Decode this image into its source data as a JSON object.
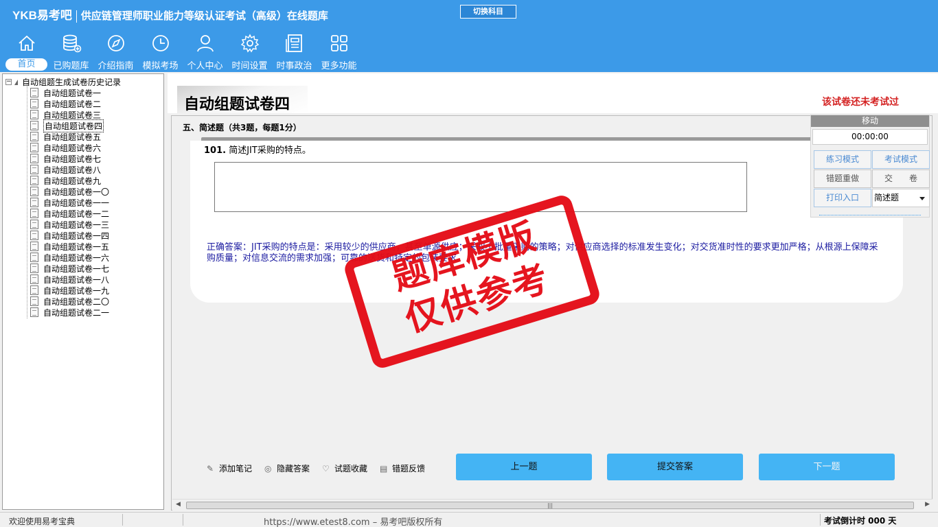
{
  "header": {
    "logo": "YKB易考吧",
    "title": "供应链管理师职业能力等级认证考试（高级）在线题库",
    "switch_label": "切换科目"
  },
  "nav": [
    {
      "label": "首页",
      "icon": "home-icon"
    },
    {
      "label": "已购题库",
      "icon": "database-icon"
    },
    {
      "label": "介绍指南",
      "icon": "compass-icon"
    },
    {
      "label": "模拟考场",
      "icon": "clock-icon"
    },
    {
      "label": "个人中心",
      "icon": "user-icon"
    },
    {
      "label": "时间设置",
      "icon": "gear-icon"
    },
    {
      "label": "时事政治",
      "icon": "newspaper-icon"
    },
    {
      "label": "更多功能",
      "icon": "grid-icon"
    }
  ],
  "tree": {
    "root": "自动组题生成试卷历史记录",
    "items": [
      "自动组题试卷一",
      "自动组题试卷二",
      "自动组题试卷三",
      "自动组题试卷四",
      "自动组题试卷五",
      "自动组题试卷六",
      "自动组题试卷七",
      "自动组题试卷八",
      "自动组题试卷九",
      "自动组题试卷一〇",
      "自动组题试卷一一",
      "自动组题试卷一二",
      "自动组题试卷一三",
      "自动组题试卷一四",
      "自动组题试卷一五",
      "自动组题试卷一六",
      "自动组题试卷一七",
      "自动组题试卷一八",
      "自动组题试卷一九",
      "自动组题试卷二〇",
      "自动组题试卷二一"
    ],
    "selected_index": 3
  },
  "paper": {
    "title": "自动组题试卷四",
    "status": "该试卷还未考试过",
    "section": "五、简述题（共3题，每题1分）",
    "question_number": "101.",
    "question_text": " 简述JIT采购的特点。",
    "answer_value": "",
    "correct_answer": "正确答案：JIT采购的特点是：采用较少的供应商，甚至单源供应；采取小批量采购的策略；对供应商选择的标准发生变化；对交货准时性的要求更加严格；从根源上保障采购质量；对信息交流的需求加强；可靠的送货和特定的包装要求。"
  },
  "float_panel": {
    "move_label": "移动",
    "timer": "00:00:00",
    "practice_mode": "练习模式",
    "exam_mode": "考试模式",
    "redo_wrong": "错题重做",
    "submit_paper": "交　　卷",
    "print_entry": "打印入口",
    "question_type": "简述题"
  },
  "tools": {
    "add_note": "添加笔记",
    "hide_answer": "隐藏答案",
    "favorite": "试题收藏",
    "feedback": "错题反馈"
  },
  "buttons": {
    "prev": "上一题",
    "submit": "提交答案",
    "next": "下一题"
  },
  "statusbar": {
    "welcome": "欢迎使用易考宝典",
    "site": "https://www.etest8.com – 易考吧版权所有",
    "countdown": "考试倒计时 000 天"
  },
  "watermark": {
    "line1": "题库模版",
    "line2": "仅供参考"
  },
  "colors": {
    "header_bg": "#3c9ae8",
    "action_button": "#44b4f4",
    "status_red": "#d42222",
    "answer_blue": "#1a1aa0",
    "stamp_red": "#e40c16"
  }
}
